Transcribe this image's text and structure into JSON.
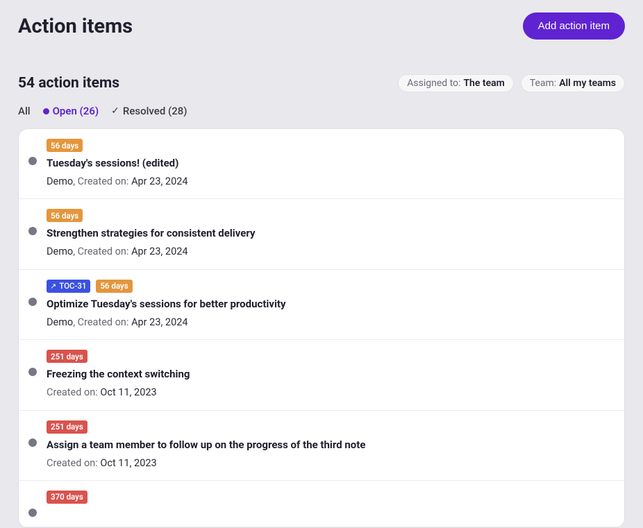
{
  "header": {
    "title": "Action items",
    "add_button": "Add action item"
  },
  "summary": {
    "count_text": "54 action items"
  },
  "filters": {
    "assigned": {
      "label": "Assigned to:",
      "value": "The team"
    },
    "team": {
      "label": "Team:",
      "value": "All my teams"
    }
  },
  "tabs": {
    "all": "All",
    "open": "Open (26)",
    "resolved": "Resolved (28)"
  },
  "meta_labels": {
    "created_on": "Created on:"
  },
  "items": [
    {
      "age_label": "56 days",
      "age_color": "amber",
      "link_chip": null,
      "title": "Tuesday's sessions! (edited)",
      "team": "Demo",
      "created": "Apr 23, 2024"
    },
    {
      "age_label": "56 days",
      "age_color": "amber",
      "link_chip": null,
      "title": "Strengthen strategies for consistent delivery",
      "team": "Demo",
      "created": "Apr 23, 2024"
    },
    {
      "age_label": "56 days",
      "age_color": "amber",
      "link_chip": "TOC-31",
      "title": "Optimize Tuesday's sessions for better productivity",
      "team": "Demo",
      "created": "Apr 23, 2024"
    },
    {
      "age_label": "251 days",
      "age_color": "red",
      "link_chip": null,
      "title": "Freezing the context switching",
      "team": null,
      "created": "Oct 11, 2023"
    },
    {
      "age_label": "251 days",
      "age_color": "red",
      "link_chip": null,
      "title": "Assign a team member to follow up on the progress of the third note",
      "team": null,
      "created": "Oct 11, 2023"
    },
    {
      "age_label": "370 days",
      "age_color": "red",
      "link_chip": null,
      "title": "",
      "team": null,
      "created": ""
    }
  ]
}
